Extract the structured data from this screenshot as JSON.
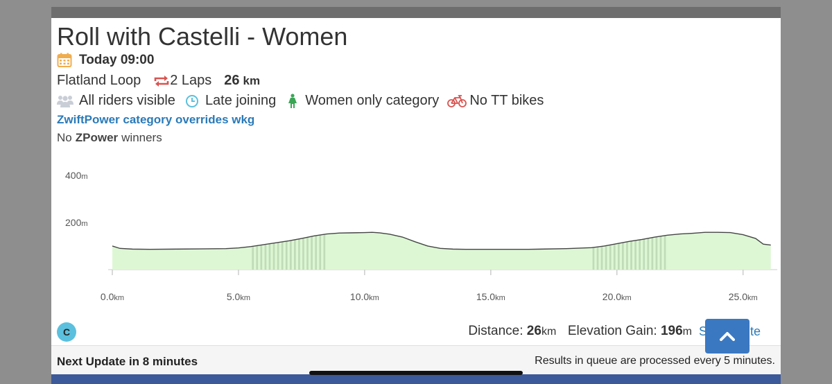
{
  "event": {
    "title": "Roll with Castelli - Women",
    "datetime": "Today 09:00",
    "route": "Flatland Loop",
    "laps": "2 Laps",
    "distance_value": "26",
    "distance_unit": "km",
    "tags": {
      "visibility": "All riders visible",
      "late_join": "Late joining",
      "category": "Women only category",
      "bikes": "No TT bikes"
    },
    "zp_link": "ZwiftPower category overrides wkg",
    "zpower_prefix": "No",
    "zpower_bold": "ZPower",
    "zpower_suffix": "winners"
  },
  "colors": {
    "link": "#2a7ab8",
    "calendar": "#f0ad4e",
    "laps": "#d9534f",
    "clock": "#5bc0de",
    "women": "#3aa655",
    "bike": "#d9534f",
    "profile_fill": "#ddf7d4",
    "profile_dark": "#a7c4a0"
  },
  "chart_data": {
    "type": "area",
    "title": "",
    "xlabel": "",
    "ylabel": "",
    "x_unit": "km",
    "y_unit": "m",
    "xlim": [
      0,
      26.3
    ],
    "ylim": [
      0,
      420
    ],
    "x_ticks": [
      {
        "value": 0,
        "num": "0.0",
        "unit": "km"
      },
      {
        "value": 5,
        "num": "5.0",
        "unit": "km"
      },
      {
        "value": 10,
        "num": "10.0",
        "unit": "km"
      },
      {
        "value": 15,
        "num": "15.0",
        "unit": "km"
      },
      {
        "value": 20,
        "num": "20.0",
        "unit": "km"
      },
      {
        "value": 25,
        "num": "25.0",
        "unit": "km"
      }
    ],
    "y_ticks": [
      {
        "value": 400,
        "num": "400",
        "unit": "m"
      },
      {
        "value": 200,
        "num": "200",
        "unit": "m"
      }
    ],
    "series": [
      {
        "x": [
          0,
          0.3,
          0.8,
          1.5,
          2.5,
          3.5,
          4.5,
          5.0,
          5.5,
          6.0,
          6.5,
          7.0,
          7.5,
          8.0,
          8.5,
          9.0,
          9.5,
          10.0,
          10.3,
          10.6,
          11.0,
          11.5,
          12.0,
          12.5,
          13.0,
          13.5,
          14.0,
          14.5,
          15.0,
          15.5,
          16.0,
          16.5,
          17.0,
          18.0,
          19.0,
          19.5,
          20.0,
          20.5,
          21.0,
          21.5,
          22.0,
          22.5,
          23.0,
          23.5,
          24.0,
          24.5,
          25.0,
          25.5,
          25.8,
          26.1
        ],
        "y": [
          100,
          90,
          87,
          86,
          87,
          88,
          89,
          92,
          98,
          106,
          114,
          122,
          132,
          143,
          151,
          155,
          156,
          157,
          158,
          156,
          150,
          138,
          118,
          100,
          90,
          87,
          86,
          86,
          86,
          86,
          86,
          86,
          87,
          89,
          93,
          100,
          110,
          120,
          128,
          138,
          146,
          151,
          154,
          158,
          158,
          157,
          148,
          132,
          108,
          104
        ]
      }
    ]
  },
  "stats": {
    "distance_label": "Distance:",
    "distance_value": "26",
    "distance_unit": "km",
    "elevation_label": "Elevation Gain:",
    "elevation_value": "196",
    "elevation_unit": "m",
    "strava_link": "S",
    "strava_link_tail": "ute"
  },
  "badge": "C",
  "footer": {
    "next_update": "Next Update in 8 minutes",
    "queue_note": "Results in queue are processed every 5 minutes."
  }
}
